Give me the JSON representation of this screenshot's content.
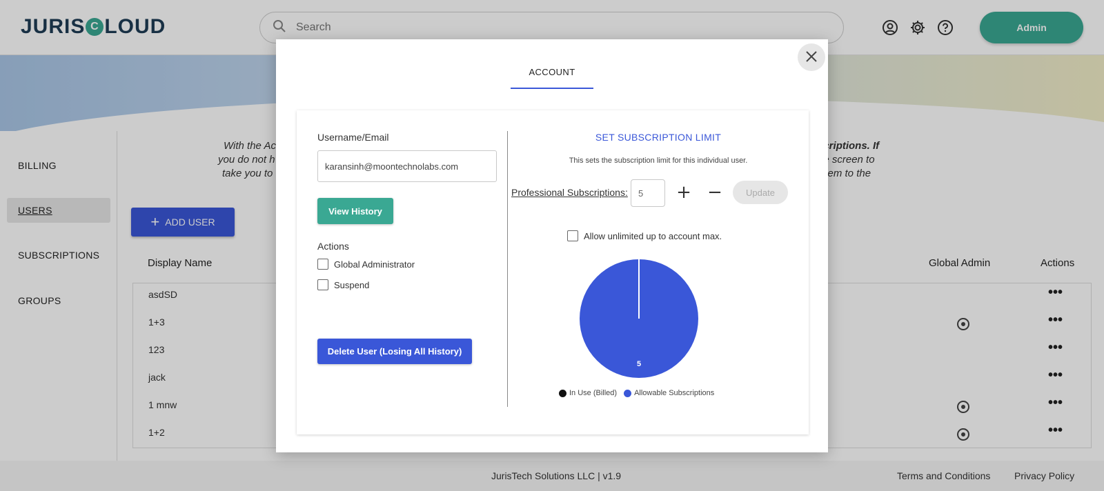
{
  "app": {
    "logo_text_left": "JURIS",
    "logo_text_right": "LOUD",
    "logo_mark": "C"
  },
  "header": {
    "search_placeholder": "Search",
    "icons": [
      "user-circle-icon",
      "gear-icon",
      "help-icon"
    ],
    "admin_label": "Admin"
  },
  "sidebar": {
    "items": [
      {
        "label": "BILLING",
        "active": false
      },
      {
        "label": "USERS",
        "active": true
      },
      {
        "label": "SUBSCRIPTIONS",
        "active": false
      },
      {
        "label": "GROUPS",
        "active": false
      }
    ]
  },
  "page": {
    "intro_left": [
      "With the Ac",
      "you do not h",
      "take you to"
    ],
    "intro_right": [
      "scriptions. If",
      "he screen to",
      "them to the"
    ],
    "add_user_label": "ADD USER",
    "columns": {
      "display_name": "Display Name",
      "global_admin": "Global Admin",
      "actions": "Actions"
    },
    "rows": [
      {
        "name": "asdSD",
        "admin": false
      },
      {
        "name": "1+3",
        "admin": true
      },
      {
        "name": "123",
        "admin": false
      },
      {
        "name": "jack",
        "admin": false
      },
      {
        "name": "1 mnw",
        "admin": true
      },
      {
        "name": "1+2",
        "admin": true
      }
    ],
    "row_actions_glyph": "•••"
  },
  "footer": {
    "center": "JurisTech Solutions LLC | v1.9",
    "terms": "Terms and Conditions",
    "privacy": "Privacy Policy"
  },
  "modal": {
    "tab": "ACCOUNT",
    "username_label": "Username/Email",
    "email_value": "karansinh@moontechnolabs.com",
    "view_history": "View History",
    "actions_label": "Actions",
    "checkbox_global_admin": "Global Administrator",
    "checkbox_suspend": "Suspend",
    "delete_button": "Delete User (Losing All History)",
    "set_limit_title": "SET SUBSCRIPTION LIMIT",
    "set_limit_desc": "This sets the subscription limit for this individual user.",
    "professional_label": "Professional Subscriptions:",
    "professional_value": "5",
    "plus_glyph": "+",
    "minus_glyph": "−",
    "update_label": "Update",
    "unlimited_label": "Allow unlimited up to account max."
  },
  "colors": {
    "accent_teal": "#3aa893",
    "accent_blue": "#3a57d8",
    "in_use": "#111111",
    "allowable": "#3a57d8"
  },
  "chart_data": {
    "type": "pie",
    "series": [
      {
        "name": "In Use (Billed)",
        "value": 0
      },
      {
        "name": "Allowable Subscriptions",
        "value": 5
      }
    ],
    "data_label": "5",
    "legend": "bottom"
  }
}
